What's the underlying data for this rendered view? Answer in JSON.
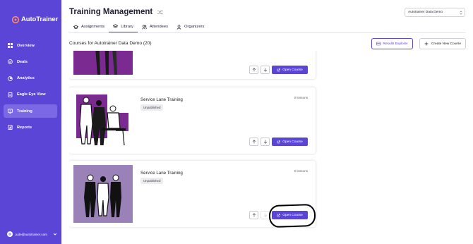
{
  "app": {
    "name": "AutoTrainer"
  },
  "colors": {
    "brand": "#5b45d6",
    "sidebar_active": "#7a68e4",
    "img_purple": "#7b2a92",
    "img_lilac": "#9a82b8"
  },
  "sidebar": {
    "items": [
      {
        "label": "Overview",
        "icon": "grid-icon"
      },
      {
        "label": "Deals",
        "icon": "deals-icon"
      },
      {
        "label": "Analytics",
        "icon": "analytics-icon"
      },
      {
        "label": "Eagle Eye View",
        "icon": "document-icon"
      },
      {
        "label": "Training",
        "icon": "training-icon",
        "active": true
      },
      {
        "label": "Reports",
        "icon": "reports-icon"
      }
    ],
    "user_email": "jude@autotrainer.com"
  },
  "header": {
    "title": "Training Management",
    "org_select": "Autotrainer Data Demo"
  },
  "tabs": [
    {
      "label": "Assignments",
      "icon": "graduation-cap-icon"
    },
    {
      "label": "Library",
      "icon": "layers-icon",
      "active": true
    },
    {
      "label": "Attendees",
      "icon": "users-icon"
    },
    {
      "label": "Organizers",
      "icon": "user-icon"
    }
  ],
  "library": {
    "heading": "Courses for Autotrainer Data Demo (20)",
    "results_explorer": "Results Explorer",
    "create_course": "Create New Course",
    "open_course_label": "Open Course",
    "courses": [
      {
        "title": "",
        "status": "",
        "lessons": ""
      },
      {
        "title": "Service Lane Training",
        "status": "Unpublished",
        "lessons": "0 lessons"
      },
      {
        "title": "Service Lane Training",
        "status": "Unpublished",
        "lessons": "0 lessons"
      }
    ]
  }
}
